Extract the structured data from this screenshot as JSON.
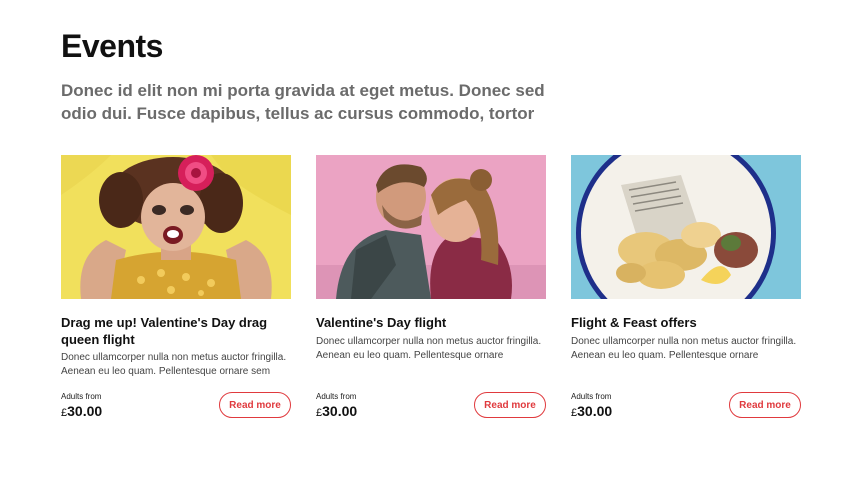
{
  "section": {
    "title": "Events",
    "intro": "Donec id elit non mi porta gravida at eget metus. Donec sed odio dui. Fusce dapibus, tellus ac cursus commodo, tortor"
  },
  "colors": {
    "accent": "#e03a3e",
    "text_dark": "#111111",
    "text_muted": "#6b6b6b"
  },
  "cards": [
    {
      "title": "Drag me up! Valentine's Day drag queen flight",
      "description": "Donec ullamcorper nulla non metus auctor fringilla. Aenean eu leo quam. Pellentesque ornare sem",
      "price_label": "Adults from",
      "currency": "£",
      "price": "30.00",
      "button": "Read more"
    },
    {
      "title": "Valentine's Day flight",
      "description": "Donec ullamcorper nulla non metus auctor fringilla. Aenean eu leo quam. Pellentesque ornare",
      "price_label": "Adults from",
      "currency": "£",
      "price": "30.00",
      "button": "Read more"
    },
    {
      "title": "Flight & Feast offers",
      "description": "Donec ullamcorper nulla non metus auctor fringilla. Aenean eu leo quam. Pellentesque ornare",
      "price_label": "Adults from",
      "currency": "£",
      "price": "30.00",
      "button": "Read more"
    }
  ]
}
